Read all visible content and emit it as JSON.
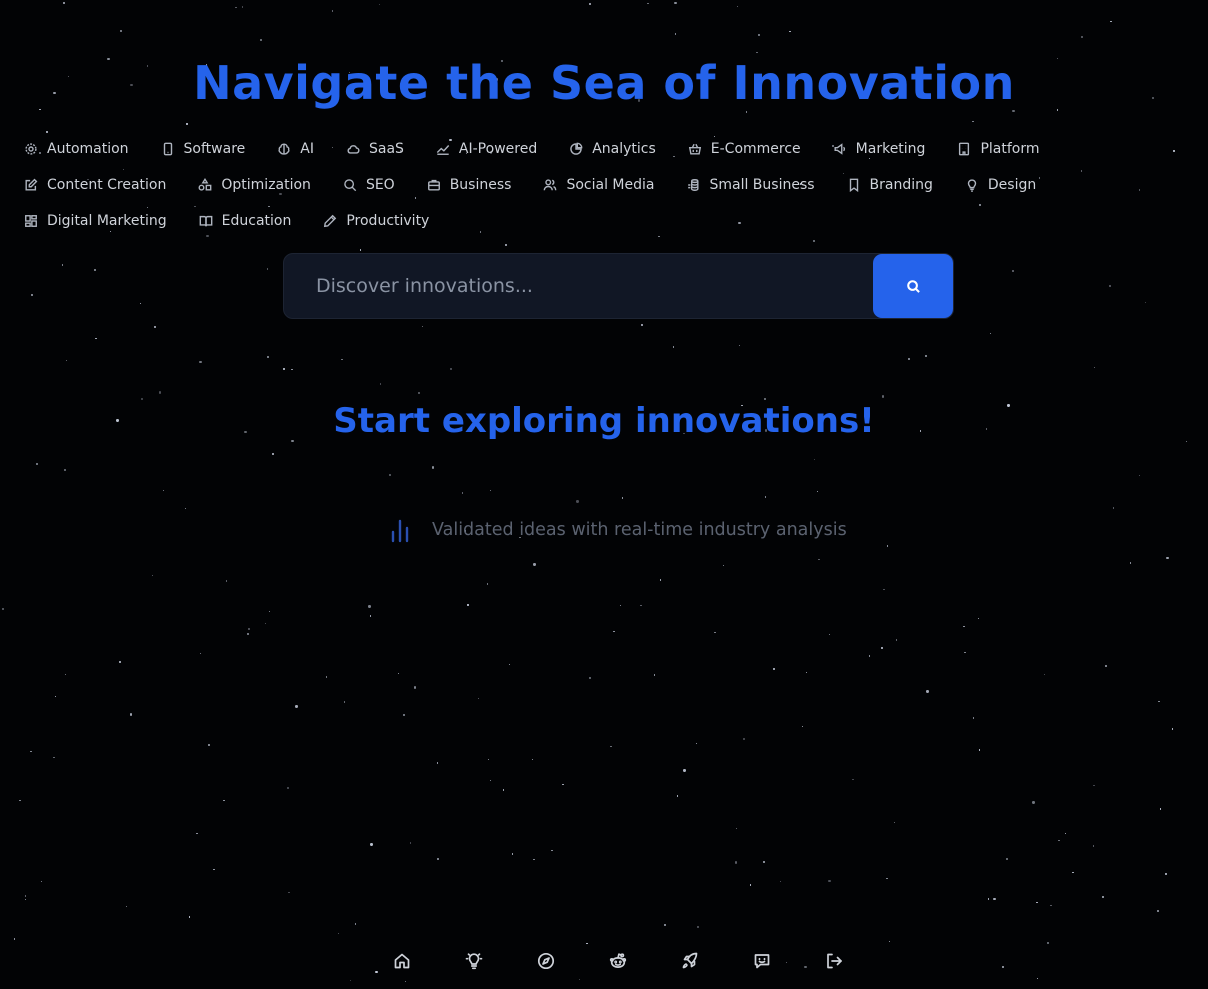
{
  "hero": {
    "title": "Navigate the Sea of Innovation"
  },
  "categories": [
    {
      "label": "Automation",
      "icon": "gear-icon"
    },
    {
      "label": "Software",
      "icon": "smartphone-icon"
    },
    {
      "label": "AI",
      "icon": "brain-icon"
    },
    {
      "label": "SaaS",
      "icon": "cloud-icon"
    },
    {
      "label": "AI-Powered",
      "icon": "trend-line-icon"
    },
    {
      "label": "Analytics",
      "icon": "pie-chart-icon"
    },
    {
      "label": "E-Commerce",
      "icon": "shopping-basket-icon"
    },
    {
      "label": "Marketing",
      "icon": "megaphone-icon"
    },
    {
      "label": "Platform",
      "icon": "building-icon"
    },
    {
      "label": "Content Creation",
      "icon": "edit-icon"
    },
    {
      "label": "Optimization",
      "icon": "shapes-icon"
    },
    {
      "label": "SEO",
      "icon": "search-icon"
    },
    {
      "label": "Business",
      "icon": "briefcase-icon"
    },
    {
      "label": "Social Media",
      "icon": "users-icon"
    },
    {
      "label": "Small Business",
      "icon": "coins-icon"
    },
    {
      "label": "Branding",
      "icon": "bookmark-icon"
    },
    {
      "label": "Design",
      "icon": "lightbulb-icon"
    },
    {
      "label": "Digital Marketing",
      "icon": "dashboard-icon"
    },
    {
      "label": "Education",
      "icon": "book-open-icon"
    },
    {
      "label": "Productivity",
      "icon": "pencil-icon"
    }
  ],
  "search": {
    "placeholder": "Discover innovations..."
  },
  "main": {
    "explore_title": "Start exploring innovations!",
    "feature_text": "Validated ideas with real-time industry analysis",
    "feature_icon": "bar-chart-icon"
  },
  "bottom_nav": [
    {
      "icon": "home-icon"
    },
    {
      "icon": "lightbulb-icon"
    },
    {
      "icon": "compass-icon"
    },
    {
      "icon": "reddit-icon"
    },
    {
      "icon": "rocket-icon"
    },
    {
      "icon": "message-square-icon"
    },
    {
      "icon": "logout-icon"
    }
  ],
  "colors": {
    "background": "#020305",
    "accent": "#2563eb",
    "search_bg": "#111725"
  }
}
